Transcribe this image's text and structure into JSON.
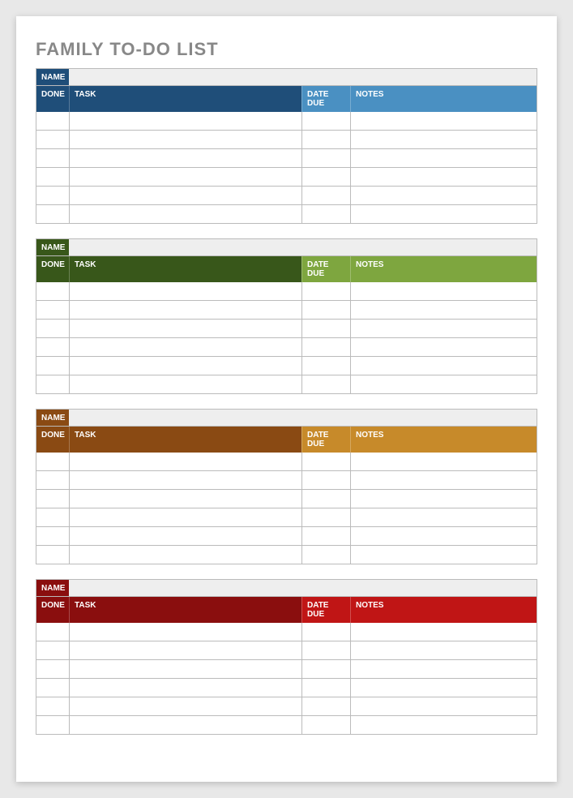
{
  "title": "FAMILY TO-DO LIST",
  "labels": {
    "name": "NAME",
    "done": "DONE",
    "task": "TASK",
    "date_due": "DATE DUE",
    "notes": "NOTES"
  },
  "sections": [
    {
      "name_value": "",
      "colors": {
        "name_bg": "#1f4e79",
        "header_left_bg": "#1f4e79",
        "header_right_bg": "#4a90c2"
      },
      "rows": [
        {
          "done": "",
          "task": "",
          "date_due": "",
          "notes": ""
        },
        {
          "done": "",
          "task": "",
          "date_due": "",
          "notes": ""
        },
        {
          "done": "",
          "task": "",
          "date_due": "",
          "notes": ""
        },
        {
          "done": "",
          "task": "",
          "date_due": "",
          "notes": ""
        },
        {
          "done": "",
          "task": "",
          "date_due": "",
          "notes": ""
        },
        {
          "done": "",
          "task": "",
          "date_due": "",
          "notes": ""
        }
      ]
    },
    {
      "name_value": "",
      "colors": {
        "name_bg": "#38571a",
        "header_left_bg": "#38571a",
        "header_right_bg": "#7ea63f"
      },
      "rows": [
        {
          "done": "",
          "task": "",
          "date_due": "",
          "notes": ""
        },
        {
          "done": "",
          "task": "",
          "date_due": "",
          "notes": ""
        },
        {
          "done": "",
          "task": "",
          "date_due": "",
          "notes": ""
        },
        {
          "done": "",
          "task": "",
          "date_due": "",
          "notes": ""
        },
        {
          "done": "",
          "task": "",
          "date_due": "",
          "notes": ""
        },
        {
          "done": "",
          "task": "",
          "date_due": "",
          "notes": ""
        }
      ]
    },
    {
      "name_value": "",
      "colors": {
        "name_bg": "#8a4a13",
        "header_left_bg": "#8a4a13",
        "header_right_bg": "#c78a2a"
      },
      "rows": [
        {
          "done": "",
          "task": "",
          "date_due": "",
          "notes": ""
        },
        {
          "done": "",
          "task": "",
          "date_due": "",
          "notes": ""
        },
        {
          "done": "",
          "task": "",
          "date_due": "",
          "notes": ""
        },
        {
          "done": "",
          "task": "",
          "date_due": "",
          "notes": ""
        },
        {
          "done": "",
          "task": "",
          "date_due": "",
          "notes": ""
        },
        {
          "done": "",
          "task": "",
          "date_due": "",
          "notes": ""
        }
      ]
    },
    {
      "name_value": "",
      "colors": {
        "name_bg": "#8a0e0e",
        "header_left_bg": "#8a0e0e",
        "header_right_bg": "#c01515"
      },
      "rows": [
        {
          "done": "",
          "task": "",
          "date_due": "",
          "notes": ""
        },
        {
          "done": "",
          "task": "",
          "date_due": "",
          "notes": ""
        },
        {
          "done": "",
          "task": "",
          "date_due": "",
          "notes": ""
        },
        {
          "done": "",
          "task": "",
          "date_due": "",
          "notes": ""
        },
        {
          "done": "",
          "task": "",
          "date_due": "",
          "notes": ""
        },
        {
          "done": "",
          "task": "",
          "date_due": "",
          "notes": ""
        }
      ]
    }
  ]
}
